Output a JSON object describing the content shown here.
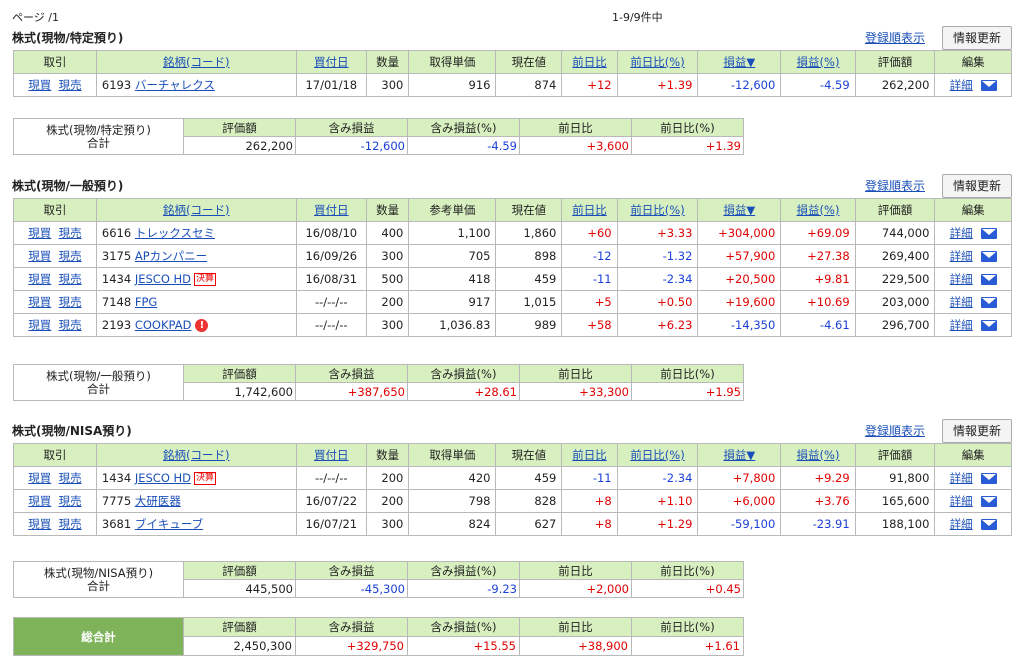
{
  "page_label": "ページ /1",
  "count_label": "1-9/9件中",
  "sort_link": "登録順表示",
  "refresh_label": "情報更新",
  "buy": "現買",
  "sell": "現売",
  "detail": "詳細",
  "kessan": "決算",
  "sections": [
    {
      "title": "株式(現物/特定預り)",
      "headers": [
        "取引",
        "銘柄(コード)",
        "買付日",
        "数量",
        "取得単価",
        "現在値",
        "前日比",
        "前日比(%)",
        "損益▼",
        "損益(%)",
        "評価額",
        "編集"
      ],
      "rows": [
        {
          "code": "6193",
          "name": "バーチャレクス",
          "date": "17/01/18",
          "qty": "300",
          "price": "916",
          "cur": "874",
          "chg": "+12",
          "chgp": "+1.39",
          "pl": "-12,600",
          "plp": "-4.59",
          "val": "262,200"
        }
      ],
      "summary": {
        "label1": "株式(現物/特定預り)",
        "label2": "合計",
        "val": "262,200",
        "pl": "-12,600",
        "plp": "-4.59",
        "chg": "+3,600",
        "chgp": "+1.39"
      }
    },
    {
      "title": "株式(現物/一般預り)",
      "headers": [
        "取引",
        "銘柄(コード)",
        "買付日",
        "数量",
        "参考単価",
        "現在値",
        "前日比",
        "前日比(%)",
        "損益▼",
        "損益(%)",
        "評価額",
        "編集"
      ],
      "rows": [
        {
          "code": "6616",
          "name": "トレックスセミ",
          "date": "16/08/10",
          "qty": "400",
          "price": "1,100",
          "cur": "1,860",
          "chg": "+60",
          "chgp": "+3.33",
          "pl": "+304,000",
          "plp": "+69.09",
          "val": "744,000"
        },
        {
          "code": "3175",
          "name": "APカンパニー",
          "date": "16/09/26",
          "qty": "300",
          "price": "705",
          "cur": "898",
          "chg": "-12",
          "chgp": "-1.32",
          "pl": "+57,900",
          "plp": "+27.38",
          "val": "269,400"
        },
        {
          "code": "1434",
          "name": "JESCO HD",
          "date": "16/08/31",
          "qty": "500",
          "price": "418",
          "cur": "459",
          "chg": "-11",
          "chgp": "-2.34",
          "pl": "+20,500",
          "plp": "+9.81",
          "val": "229,500",
          "kessan": true
        },
        {
          "code": "7148",
          "name": "FPG",
          "date": "--/--/--",
          "qty": "200",
          "price": "917",
          "cur": "1,015",
          "chg": "+5",
          "chgp": "+0.50",
          "pl": "+19,600",
          "plp": "+10.69",
          "val": "203,000"
        },
        {
          "code": "2193",
          "name": "COOKPAD",
          "date": "--/--/--",
          "qty": "300",
          "price": "1,036.83",
          "cur": "989",
          "chg": "+58",
          "chgp": "+6.23",
          "pl": "-14,350",
          "plp": "-4.61",
          "val": "296,700",
          "alert": true
        }
      ],
      "summary": {
        "label1": "株式(現物/一般預り)",
        "label2": "合計",
        "val": "1,742,600",
        "pl": "+387,650",
        "plp": "+28.61",
        "chg": "+33,300",
        "chgp": "+1.95"
      }
    },
    {
      "title": "株式(現物/NISA預り)",
      "headers": [
        "取引",
        "銘柄(コード)",
        "買付日",
        "数量",
        "取得単価",
        "現在値",
        "前日比",
        "前日比(%)",
        "損益▼",
        "損益(%)",
        "評価額",
        "編集"
      ],
      "rows": [
        {
          "code": "1434",
          "name": "JESCO HD",
          "date": "--/--/--",
          "qty": "200",
          "price": "420",
          "cur": "459",
          "chg": "-11",
          "chgp": "-2.34",
          "pl": "+7,800",
          "plp": "+9.29",
          "val": "91,800",
          "kessan": true
        },
        {
          "code": "7775",
          "name": "大研医器",
          "date": "16/07/22",
          "qty": "200",
          "price": "798",
          "cur": "828",
          "chg": "+8",
          "chgp": "+1.10",
          "pl": "+6,000",
          "plp": "+3.76",
          "val": "165,600"
        },
        {
          "code": "3681",
          "name": "ブイキューブ",
          "date": "16/07/21",
          "qty": "300",
          "price": "824",
          "cur": "627",
          "chg": "+8",
          "chgp": "+1.29",
          "pl": "-59,100",
          "plp": "-23.91",
          "val": "188,100"
        }
      ],
      "summary": {
        "label1": "株式(現物/NISA預り)",
        "label2": "合計",
        "val": "445,500",
        "pl": "-45,300",
        "plp": "-9.23",
        "chg": "+2,000",
        "chgp": "+0.45"
      }
    }
  ],
  "summary_headers": [
    "評価額",
    "含み損益",
    "含み損益(%)",
    "前日比",
    "前日比(%)"
  ],
  "grand": {
    "title": "総合計",
    "val": "2,450,300",
    "pl": "+329,750",
    "plp": "+15.55",
    "chg": "+38,900",
    "chgp": "+1.61"
  }
}
